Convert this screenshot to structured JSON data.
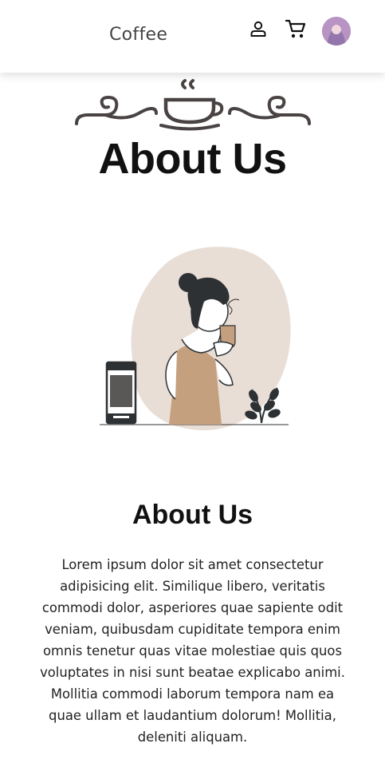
{
  "header": {
    "brand": "Coffee",
    "icons": [
      "user-icon",
      "cart-icon"
    ],
    "avatar": "avatar"
  },
  "hero": {
    "title": "About Us",
    "ornament_icon": "coffee-cup-ornament"
  },
  "illustration": {
    "icon": "woman-drinking-coffee-illustration"
  },
  "content": {
    "heading": "About Us",
    "paragraph": "Lorem ipsum dolor sit amet consectetur adipisicing elit. Similique libero, veritatis commodi dolor, asperiores quae sapiente odit veniam, quibusdam cupiditate tempora enim omnis tenetur quas vitae molestiae quis quos voluptates in nisi sunt beatae explicabo animi. Mollitia commodi laborum tempora nam ea quae ullam et laudantium dolorum! Mollitia, deleniti aliquam."
  },
  "colors": {
    "ink": "#111111",
    "ornament": "#4a4343",
    "blob": "#e9ded6",
    "dress": "#c4a07e"
  }
}
